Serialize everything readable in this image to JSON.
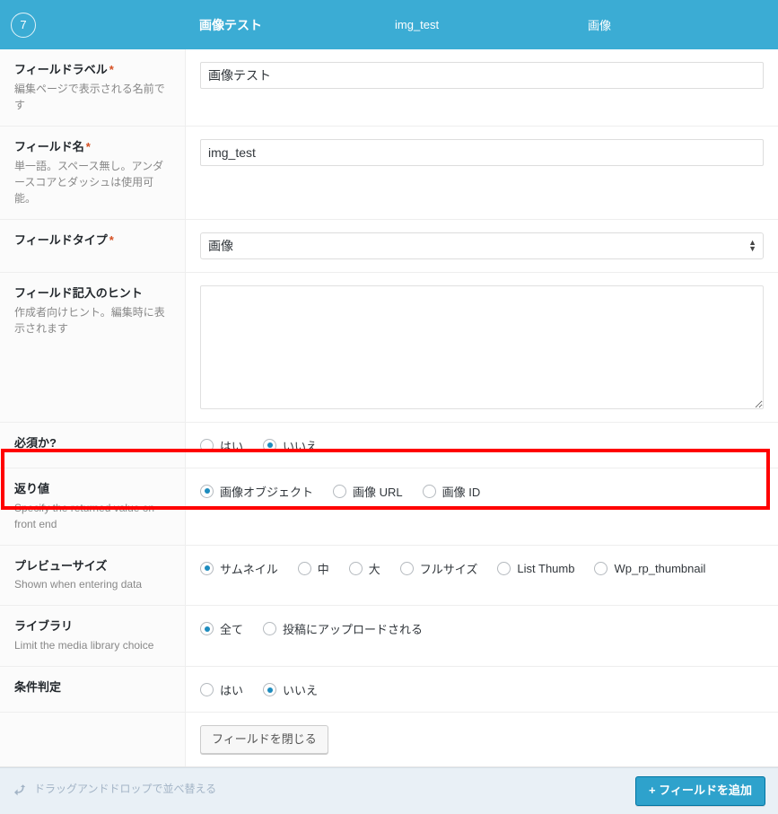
{
  "header": {
    "order_number": "7",
    "field_label": "画像テスト",
    "field_name": "img_test",
    "field_type": "画像"
  },
  "rows": {
    "label": {
      "title": "フィールドラベル",
      "required_mark": "*",
      "desc": "編集ページで表示される名前です",
      "value": "画像テスト"
    },
    "name": {
      "title": "フィールド名",
      "required_mark": "*",
      "desc": "単一語。スペース無し。アンダースコアとダッシュは使用可能。",
      "value": "img_test"
    },
    "type": {
      "title": "フィールドタイプ",
      "required_mark": "*",
      "selected": "画像"
    },
    "instructions": {
      "title": "フィールド記入のヒント",
      "desc": "作成者向けヒント。編集時に表示されます",
      "value": ""
    },
    "required": {
      "title": "必須か?",
      "options": [
        {
          "label": "はい",
          "selected": false
        },
        {
          "label": "いいえ",
          "selected": true
        }
      ]
    },
    "return_value": {
      "title": "返り値",
      "desc": "Specify the returned value on front end",
      "highlighted": true,
      "options": [
        {
          "label": "画像オブジェクト",
          "selected": true
        },
        {
          "label": "画像 URL",
          "selected": false
        },
        {
          "label": "画像 ID",
          "selected": false
        }
      ]
    },
    "preview_size": {
      "title": "プレビューサイズ",
      "desc": "Shown when entering data",
      "options": [
        {
          "label": "サムネイル",
          "selected": true
        },
        {
          "label": "中",
          "selected": false
        },
        {
          "label": "大",
          "selected": false
        },
        {
          "label": "フルサイズ",
          "selected": false
        },
        {
          "label": "List Thumb",
          "selected": false
        },
        {
          "label": "Wp_rp_thumbnail",
          "selected": false
        }
      ]
    },
    "library": {
      "title": "ライブラリ",
      "desc": "Limit the media library choice",
      "options": [
        {
          "label": "全て",
          "selected": true
        },
        {
          "label": "投稿にアップロードされる",
          "selected": false
        }
      ]
    },
    "conditional": {
      "title": "条件判定",
      "options": [
        {
          "label": "はい",
          "selected": false
        },
        {
          "label": "いいえ",
          "selected": true
        }
      ]
    },
    "close": {
      "button_label": "フィールドを閉じる"
    }
  },
  "footer": {
    "drag_hint": "ドラッグアンドドロップで並べ替える",
    "add_field_label": "+ フィールドを追加"
  },
  "colors": {
    "header_bg": "#3bacd4",
    "highlight": "#ff0000",
    "radio_accent": "#1e8cbe",
    "primary_button": "#2ea2cc",
    "footer_bg": "#e9f0f6",
    "required_mark": "#d54e21"
  }
}
